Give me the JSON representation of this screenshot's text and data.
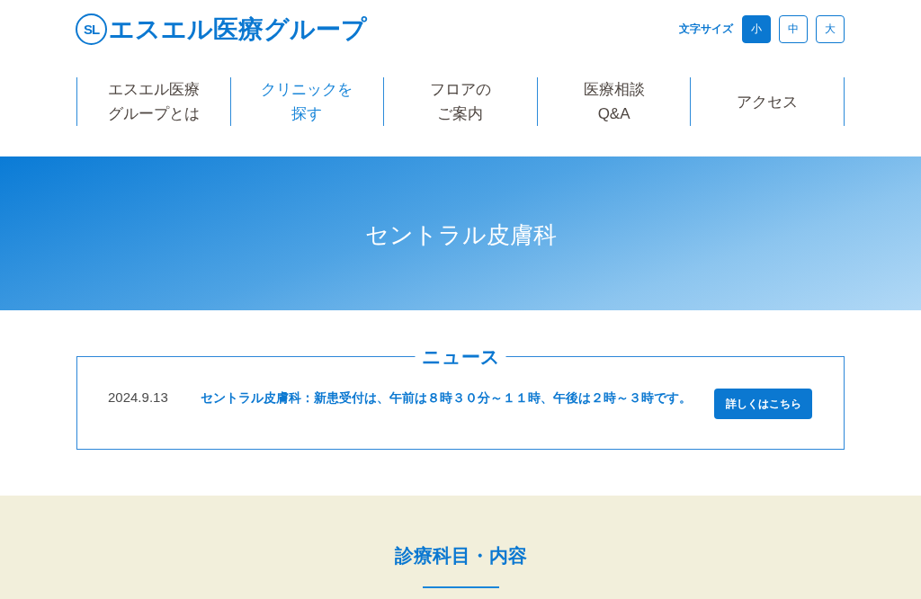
{
  "logo": {
    "mark": "SL",
    "text": "エスエル医療グループ"
  },
  "font_size": {
    "label": "文字サイズ",
    "options": [
      {
        "label": "小",
        "selected": true
      },
      {
        "label": "中",
        "selected": false
      },
      {
        "label": "大",
        "selected": false
      }
    ]
  },
  "nav": [
    {
      "label": "エスエル医療グループとは",
      "selected": false
    },
    {
      "label": "クリニックを探す",
      "selected": true
    },
    {
      "label": "フロアのご案内",
      "selected": false
    },
    {
      "label": "医療相談Q&A",
      "selected": false
    },
    {
      "label": "アクセス",
      "selected": false
    }
  ],
  "hero": {
    "title": "セントラル皮膚科"
  },
  "news": {
    "heading": "ニュース",
    "items": [
      {
        "date": "2024.9.13",
        "text": "セントラル皮膚科：新患受付は、午前は８時３０分～１１時、午後は２時～３時です。",
        "button": "詳しくはこちら"
      }
    ]
  },
  "section": {
    "heading": "診療科目・内容"
  }
}
